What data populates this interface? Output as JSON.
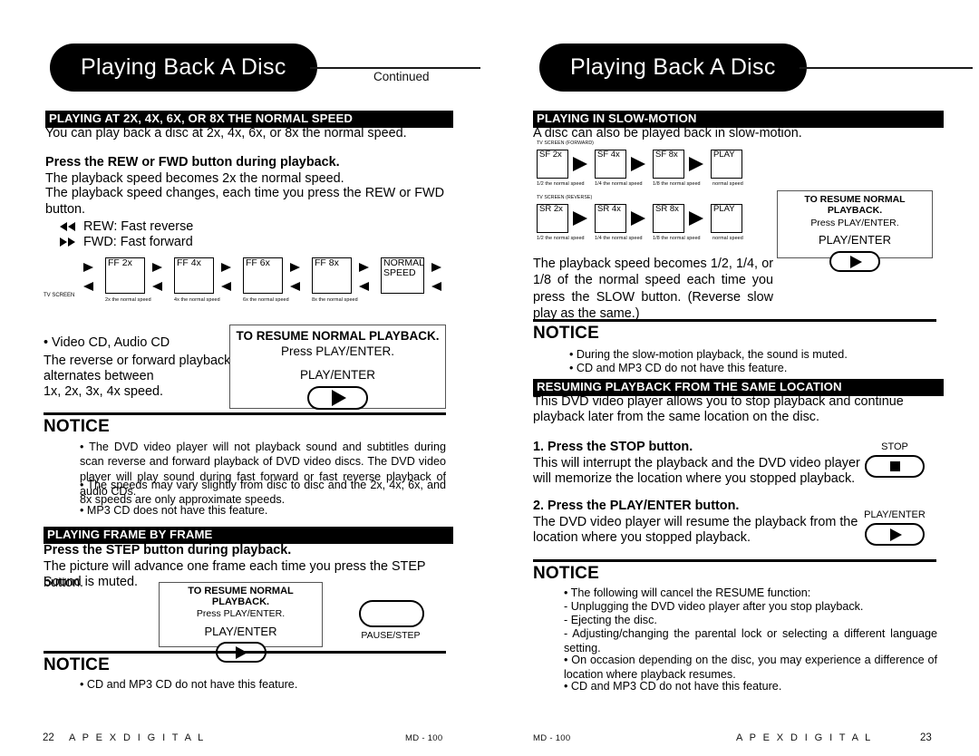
{
  "document": {
    "left_page": {
      "title": "Playing Back A Disc",
      "continued_label": "Continued",
      "page_number": "22",
      "brand": "A P E X   D I G I T A L",
      "model": "MD - 100",
      "sections": [
        {
          "heading": "PLAYING AT 2X, 4X, 6X, OR 8X THE NORMAL SPEED",
          "intro": "You can play back a disc at 2x, 4x, 6x, or 8x the normal speed.",
          "step_bold": "Press the REW or FWD button during playback.",
          "body1": "The playback speed becomes 2x the normal speed.",
          "body2": "The playback speed changes, each time you press the REW or FWD button.",
          "legend": [
            {
              "icon": "rewind-icon",
              "label": "REW:  Fast reverse"
            },
            {
              "icon": "fast-forward-icon",
              "label": "FWD:  Fast forward"
            }
          ],
          "diagram": {
            "tv_screen_label": "TV SCREEN",
            "steps": [
              {
                "screen": "FF 2x",
                "caption": "2x the normal speed"
              },
              {
                "screen": "FF 4x",
                "caption": "4x the normal speed"
              },
              {
                "screen": "FF 6x",
                "caption": "6x the normal speed"
              },
              {
                "screen": "FF 8x",
                "caption": "8x the normal speed"
              },
              {
                "screen": "NORMAL\nSPEED",
                "caption": ""
              }
            ]
          },
          "cd_note": {
            "bullet": "• Video CD, Audio CD",
            "line1": "The reverse or forward playback",
            "line2": "alternates between",
            "line3": "1x, 2x, 3x, 4x speed."
          }
        }
      ],
      "resume_box_1": {
        "title": "TO RESUME NORMAL PLAYBACK.",
        "subtitle": "Press PLAY/ENTER.",
        "key_label": "PLAY/ENTER",
        "key_icon": "play-icon"
      },
      "notice_1": {
        "heading": "NOTICE",
        "items": [
          "• The DVD video player will not playback sound and subtitles during scan reverse and forward playback of DVD video discs. The DVD video player will play sound during fast forward or fast reverse playback of audio CDs.",
          "• The speeds may vary slightly from disc to disc and the 2x, 4x, 6x, and 8x speeds are only approximate speeds.",
          "• MP3 CD does not have this feature."
        ]
      },
      "frame_section": {
        "heading": "PLAYING FRAME BY FRAME",
        "step_bold": "Press the STEP button during playback.",
        "body1": "The picture will advance one frame each time you press the STEP button.",
        "body2": "Sound is muted."
      },
      "resume_box_2": {
        "title": "TO RESUME NORMAL PLAYBACK.",
        "subtitle": "Press PLAY/ENTER.",
        "key_label": "PLAY/ENTER",
        "key_icon": "play-icon"
      },
      "pause_step_button": {
        "label": "PAUSE/STEP"
      },
      "notice_2": {
        "heading": "NOTICE",
        "items": [
          "• CD and MP3 CD do not have this feature."
        ]
      }
    },
    "right_page": {
      "title": "Playing Back A Disc",
      "page_number": "23",
      "brand": "A P E X   D I G I T A L",
      "model": "MD - 100",
      "slow_section": {
        "heading": "PLAYING IN SLOW-MOTION",
        "intro": "A disc can also be played back in slow-motion.",
        "diagram_forward": {
          "tv_screen_label": "TV SCREEN (FORWARD)",
          "steps": [
            {
              "screen": "SF 2x",
              "caption": "1/2 the normal speed"
            },
            {
              "screen": "SF 4x",
              "caption": "1/4 the normal speed"
            },
            {
              "screen": "SF 8x",
              "caption": "1/8 the normal speed"
            },
            {
              "screen": "PLAY",
              "caption": "normal speed"
            }
          ]
        },
        "diagram_reverse": {
          "tv_screen_label": "TV SCREEN (REVERSE)",
          "steps": [
            {
              "screen": "SR 2x",
              "caption": "1/2 the normal speed"
            },
            {
              "screen": "SR 4x",
              "caption": "1/4 the normal speed"
            },
            {
              "screen": "SR 8x",
              "caption": "1/8 the normal speed"
            },
            {
              "screen": "PLAY",
              "caption": "normal speed"
            }
          ]
        },
        "body": "The playback speed becomes 1/2, 1/4, or 1/8 of the normal speed each time you press the SLOW button.  (Reverse slow play as the same.)"
      },
      "resume_box": {
        "title": "TO RESUME NORMAL PLAYBACK.",
        "subtitle": "Press PLAY/ENTER.",
        "key_label": "PLAY/ENTER",
        "key_icon": "play-icon"
      },
      "notice_1": {
        "heading": "NOTICE",
        "items": [
          "• During the slow-motion playback, the sound is muted.",
          "• CD and MP3 CD do not have this feature."
        ]
      },
      "resume_section": {
        "heading": "RESUMING PLAYBACK FROM THE SAME LOCATION",
        "intro1": "This DVD video player allows you to stop playback and continue",
        "intro2": "playback later from the same location on the disc.",
        "step1_bold": "1. Press the STOP button.",
        "step1_body1": "This will interrupt the playback and the DVD video player",
        "step1_body2": "will memorize the location where you stopped playback.",
        "step1_key": {
          "label": "STOP",
          "icon": "stop-icon"
        },
        "step2_bold": "2. Press the PLAY/ENTER button.",
        "step2_body1": "The DVD video player will resume the playback from the",
        "step2_body2": "location where you stopped playback.",
        "step2_key": {
          "label": "PLAY/ENTER",
          "icon": "play-icon"
        }
      },
      "notice_2": {
        "heading": "NOTICE",
        "items": [
          "• The following will cancel the RESUME function:",
          "- Unplugging the DVD video player after you stop playback.",
          "- Ejecting the disc.",
          "-  Adjusting/changing  the  parental  lock  or  selecting  a  different  language setting.",
          "• On occasion depending on the disc, you may experience a difference of location where playback resumes.",
          "• CD and MP3 CD do not have this feature."
        ]
      }
    }
  }
}
